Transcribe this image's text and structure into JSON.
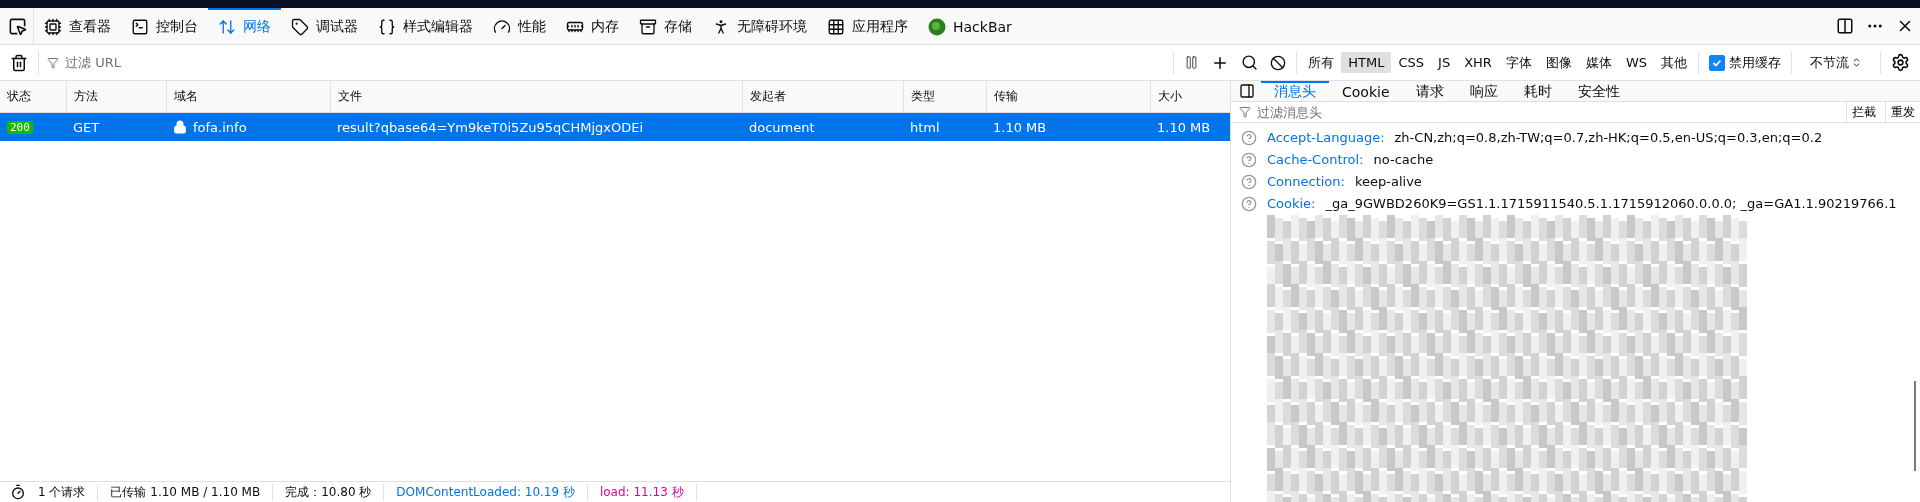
{
  "toolbox_tabs": [
    {
      "label": "查看器",
      "selected": false
    },
    {
      "label": "控制台",
      "selected": false
    },
    {
      "label": "网络",
      "selected": true
    },
    {
      "label": "调试器",
      "selected": false
    },
    {
      "label": "样式编辑器",
      "selected": false
    },
    {
      "label": "性能",
      "selected": false
    },
    {
      "label": "内存",
      "selected": false
    },
    {
      "label": "存储",
      "selected": false
    },
    {
      "label": "无障碍环境",
      "selected": false
    },
    {
      "label": "应用程序",
      "selected": false
    },
    {
      "label": "HackBar",
      "selected": false
    }
  ],
  "url_filter": {
    "placeholder": "过滤 URL"
  },
  "type_filters": [
    {
      "label": "所有",
      "selected": false
    },
    {
      "label": "HTML",
      "selected": true
    },
    {
      "label": "CSS",
      "selected": false
    },
    {
      "label": "JS",
      "selected": false
    },
    {
      "label": "XHR",
      "selected": false
    },
    {
      "label": "字体",
      "selected": false
    },
    {
      "label": "图像",
      "selected": false
    },
    {
      "label": "媒体",
      "selected": false
    },
    {
      "label": "WS",
      "selected": false
    },
    {
      "label": "其他",
      "selected": false
    }
  ],
  "disable_cache": {
    "label": "禁用缓存",
    "checked": true
  },
  "throttling": {
    "value": "不节流"
  },
  "table": {
    "columns": [
      "状态",
      "方法",
      "域名",
      "文件",
      "发起者",
      "类型",
      "传输",
      "大小"
    ],
    "rows": [
      {
        "selected": true,
        "status": "200",
        "method": "GET",
        "domain": "fofa.info",
        "file": "result?qbase64=Ym9keT0i5Zu95qCHMjgxODEi",
        "initiator": "document",
        "type": "html",
        "transferred": "1.10 MB",
        "size": "1.10 MB"
      }
    ]
  },
  "side_panel": {
    "tabs": [
      {
        "label": "消息头",
        "selected": true
      },
      {
        "label": "Cookie",
        "selected": false
      },
      {
        "label": "请求",
        "selected": false
      },
      {
        "label": "响应",
        "selected": false
      },
      {
        "label": "耗时",
        "selected": false
      },
      {
        "label": "安全性",
        "selected": false
      }
    ],
    "filter": {
      "placeholder": "过滤消息头"
    },
    "buttons": [
      "拦截",
      "重发"
    ],
    "headers": [
      {
        "name": "Accept-Language:",
        "value": "zh-CN,zh;q=0.8,zh-TW;q=0.7,zh-HK;q=0.5,en-US;q=0.3,en;q=0.2"
      },
      {
        "name": "Cache-Control:",
        "value": "no-cache"
      },
      {
        "name": "Connection:",
        "value": "keep-alive"
      },
      {
        "name": "Cookie:",
        "value": "_ga_9GWBD260K9=GS1.1.1715911540.5.1.1715912060.0.0.0; _ga=GA1.1.90219766.1"
      }
    ]
  },
  "status_bar": {
    "requests": "1 个请求",
    "transferred": "已传输 1.10 MB / 1.10 MB",
    "finish": "完成：10.80 秒",
    "dom_content_loaded": "DOMContentLoaded: 10.19 秒",
    "load": "load: 11.13 秒"
  }
}
